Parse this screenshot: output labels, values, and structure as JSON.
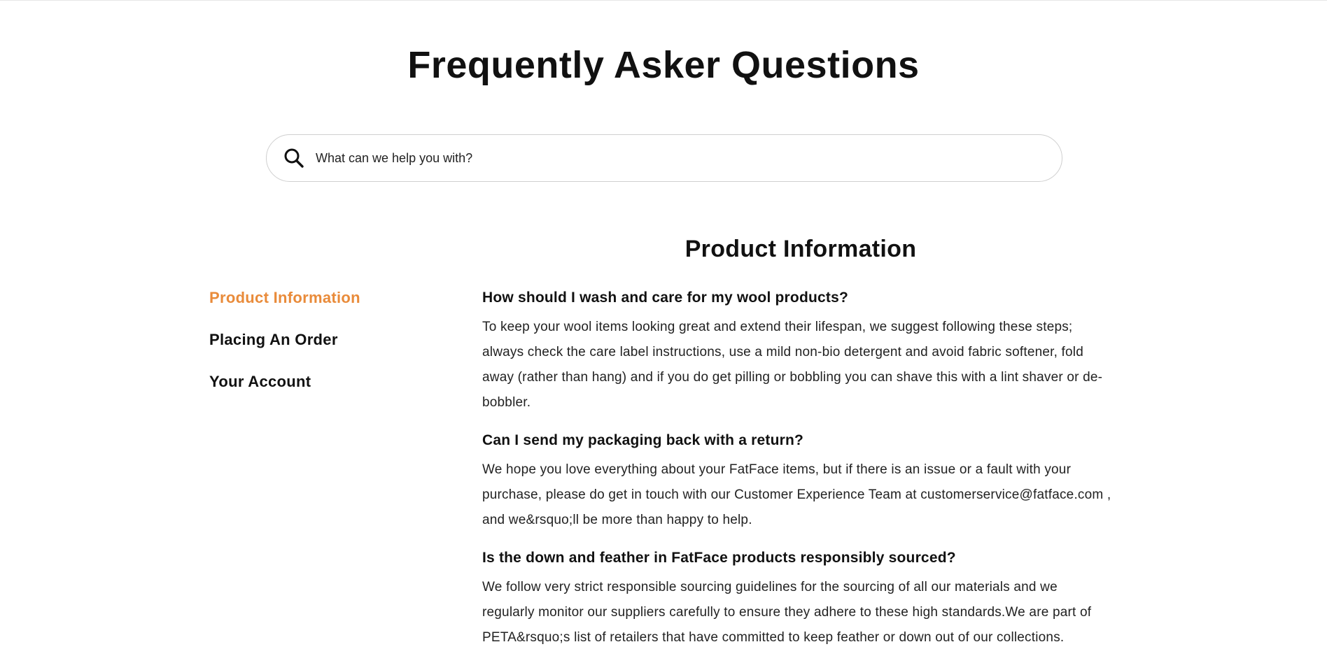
{
  "page": {
    "title": "Frequently Asker Questions"
  },
  "search": {
    "placeholder": "What can we help you with?",
    "icon": "search-icon"
  },
  "sidebar": {
    "items": [
      {
        "label": "Product Information",
        "active": true
      },
      {
        "label": "Placing An Order",
        "active": false
      },
      {
        "label": "Your Account",
        "active": false
      }
    ]
  },
  "section": {
    "title": "Product Information",
    "faqs": [
      {
        "question": "How should I wash and care for my wool products?",
        "answer": "To keep your wool items looking great and extend their lifespan, we suggest following these steps; always check the care label instructions, use a mild non-bio detergent and avoid fabric softener, fold away (rather than hang) and if you do get pilling or bobbling you can shave this with a lint shaver or de-bobbler."
      },
      {
        "question": "Can I send my packaging back with a return?",
        "answer": "We hope you love everything about your FatFace items, but if there is an issue or a fault with your purchase, please do get in touch with our Customer Experience Team at customerservice@fatface.com , and we&rsquo;ll be more than happy to help."
      },
      {
        "question": "Is the down and feather in FatFace products responsibly sourced?",
        "answer": "We follow very strict responsible sourcing guidelines for the sourcing of all our materials and we regularly monitor our suppliers carefully to ensure they adhere to these high standards.We are part of PETA&rsquo;s list of retailers that have committed to keep feather or down out of our collections."
      }
    ]
  },
  "colors": {
    "accent": "#e98b3a",
    "text": "#111111",
    "border": "#cfcfcf"
  }
}
